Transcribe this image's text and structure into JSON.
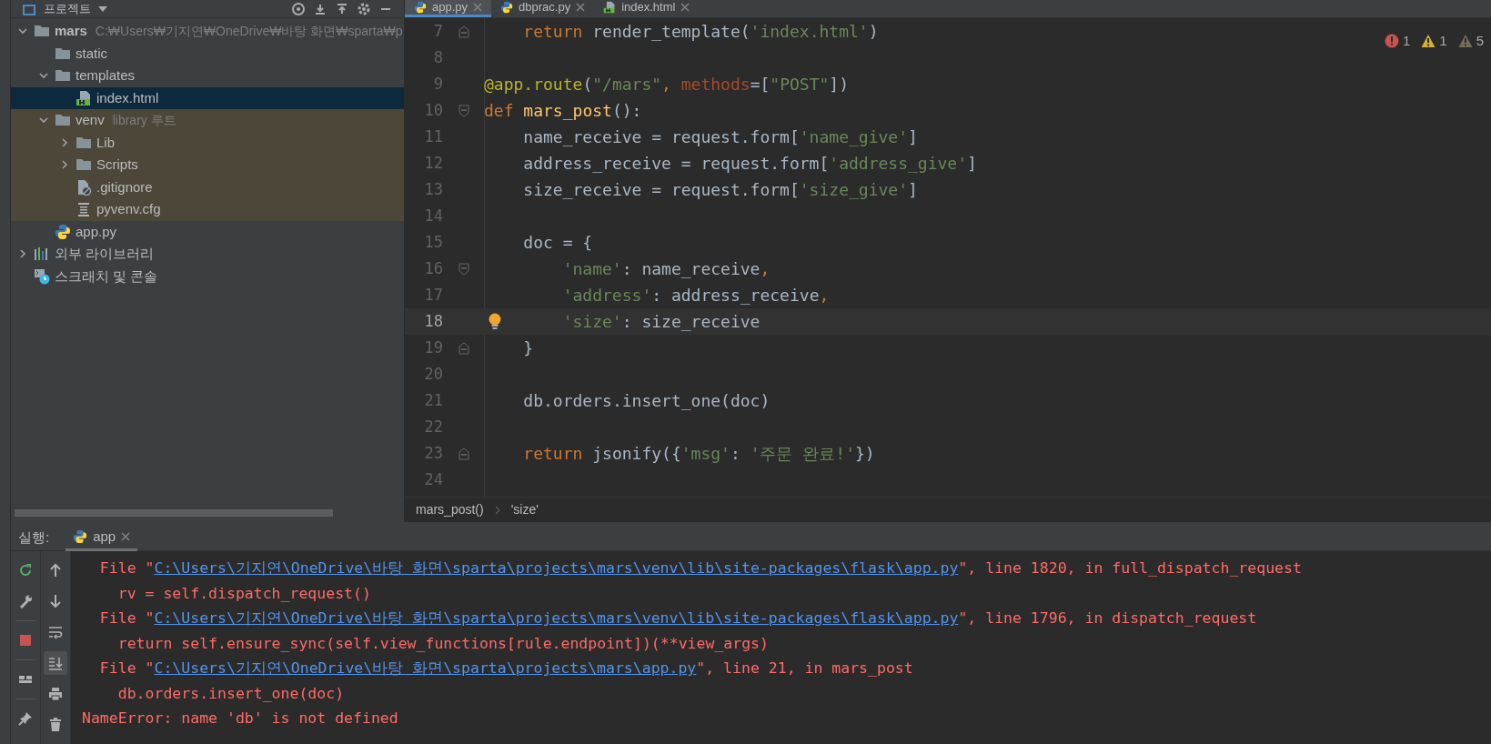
{
  "project_panel": {
    "title": "프로젝트",
    "tree": [
      {
        "label": "mars",
        "hint": "C:₩Users₩기지연₩OneDrive₩바탕 화면₩sparta₩p",
        "kind": "folder",
        "bold": true,
        "expanded": true,
        "selected": false,
        "children": [
          {
            "label": "static",
            "kind": "folder",
            "selected": false
          },
          {
            "label": "templates",
            "kind": "folder",
            "expanded": true,
            "selected": false,
            "children": [
              {
                "label": "index.html",
                "kind": "html",
                "selected": true
              }
            ]
          },
          {
            "label": "venv",
            "hint": "library 루트",
            "kind": "folder",
            "expanded": true,
            "library_root": true,
            "selected": false,
            "children": [
              {
                "label": "Lib",
                "kind": "folder",
                "expanded": false,
                "selected": false
              },
              {
                "label": "Scripts",
                "kind": "folder",
                "expanded": false,
                "selected": false
              },
              {
                "label": ".gitignore",
                "kind": "ignore",
                "selected": false
              },
              {
                "label": "pyvenv.cfg",
                "kind": "config",
                "selected": false
              }
            ]
          },
          {
            "label": "app.py",
            "kind": "python",
            "selected": false
          }
        ]
      },
      {
        "label": "외부 라이브러리",
        "kind": "library",
        "expanded": false,
        "selected": false
      },
      {
        "label": "스크래치 및 콘솔",
        "kind": "scratch",
        "selected": false
      }
    ]
  },
  "editor": {
    "tabs": [
      {
        "label": "app.py",
        "kind": "python",
        "selected": true
      },
      {
        "label": "dbprac.py",
        "kind": "python",
        "selected": false
      },
      {
        "label": "index.html",
        "kind": "html",
        "selected": false
      }
    ],
    "problems": [
      {
        "kind": "error",
        "count": "1"
      },
      {
        "kind": "warning",
        "count": "1"
      },
      {
        "kind": "weak",
        "count": "5"
      }
    ],
    "lines": [
      {
        "number": "7",
        "current": false,
        "fold_close": true,
        "tokens": [
          {
            "text": "    return",
            "kind": "kw"
          },
          {
            "text": " render_template(",
            "kind": "txt"
          },
          {
            "text": "'index.html'",
            "kind": "str"
          },
          {
            "text": ")",
            "kind": "txt"
          }
        ]
      },
      {
        "number": "8",
        "current": false
      },
      {
        "number": "9",
        "current": false,
        "tokens": [
          {
            "text": "@app.route",
            "kind": "deco"
          },
          {
            "text": "(",
            "kind": "txt"
          },
          {
            "text": "\"/mars\"",
            "kind": "str"
          },
          {
            "text": ", ",
            "kind": "kw"
          },
          {
            "text": "methods",
            "kind": "param"
          },
          {
            "text": "=[",
            "kind": "txt"
          },
          {
            "text": "\"POST\"",
            "kind": "str"
          },
          {
            "text": "])",
            "kind": "txt"
          }
        ]
      },
      {
        "number": "10",
        "current": false,
        "fold_open": true,
        "tokens": [
          {
            "text": "def ",
            "kind": "kw"
          },
          {
            "text": "mars_post",
            "kind": "fn"
          },
          {
            "text": "():",
            "kind": "txt"
          }
        ]
      },
      {
        "number": "11",
        "current": false,
        "tokens": [
          {
            "text": "    name_receive = request.form[",
            "kind": "txt"
          },
          {
            "text": "'name_give'",
            "kind": "str"
          },
          {
            "text": "]",
            "kind": "txt"
          }
        ]
      },
      {
        "number": "12",
        "current": false,
        "tokens": [
          {
            "text": "    address_receive = request.form[",
            "kind": "txt"
          },
          {
            "text": "'address_give'",
            "kind": "str"
          },
          {
            "text": "]",
            "kind": "txt"
          }
        ]
      },
      {
        "number": "13",
        "current": false,
        "tokens": [
          {
            "text": "    size_receive = request.form[",
            "kind": "txt"
          },
          {
            "text": "'size_give'",
            "kind": "str"
          },
          {
            "text": "]",
            "kind": "txt"
          }
        ]
      },
      {
        "number": "14",
        "current": false
      },
      {
        "number": "15",
        "current": false,
        "tokens": [
          {
            "text": "    doc = {",
            "kind": "txt"
          }
        ]
      },
      {
        "number": "16",
        "current": false,
        "fold_open": true,
        "tokens": [
          {
            "text": "        'name'",
            "kind": "str"
          },
          {
            "text": ": name_receive",
            "kind": "txt"
          },
          {
            "text": ",",
            "kind": "kw"
          }
        ]
      },
      {
        "number": "17",
        "current": false,
        "tokens": [
          {
            "text": "        'address'",
            "kind": "str"
          },
          {
            "text": ": address_receive",
            "kind": "txt"
          },
          {
            "text": ",",
            "kind": "kw"
          }
        ]
      },
      {
        "number": "18",
        "current": true,
        "bulb": true,
        "tokens": [
          {
            "text": "        'size'",
            "kind": "str"
          },
          {
            "text": ": size_receive",
            "kind": "txt"
          }
        ]
      },
      {
        "number": "19",
        "current": false,
        "fold_close": true,
        "tokens": [
          {
            "text": "    }",
            "kind": "txt"
          }
        ]
      },
      {
        "number": "20",
        "current": false
      },
      {
        "number": "21",
        "current": false,
        "tokens": [
          {
            "text": "    db.orders.insert_one(doc)",
            "kind": "txt"
          }
        ]
      },
      {
        "number": "22",
        "current": false
      },
      {
        "number": "23",
        "current": false,
        "fold_close": true,
        "tokens": [
          {
            "text": "    return",
            "kind": "kw"
          },
          {
            "text": " jsonify({",
            "kind": "txt"
          },
          {
            "text": "'msg'",
            "kind": "str"
          },
          {
            "text": ": ",
            "kind": "txt"
          },
          {
            "text": "'주문 완료!'",
            "kind": "str"
          },
          {
            "text": "})",
            "kind": "txt"
          }
        ]
      },
      {
        "number": "24",
        "current": false
      }
    ],
    "breadcrumbs": [
      "mars_post()",
      "'size'"
    ]
  },
  "run_panel": {
    "label": "실행:",
    "tab": {
      "label": "app",
      "selected": true
    },
    "tools_left": [
      {
        "kind": "rerun",
        "active": false
      },
      {
        "kind": "wrench",
        "active": false
      },
      {
        "kind": "stop",
        "active": false
      },
      {
        "kind": "layout",
        "active": false
      },
      {
        "kind": "pin",
        "active": false
      }
    ],
    "tools_right": [
      {
        "kind": "up",
        "active": false
      },
      {
        "kind": "down",
        "active": false
      },
      {
        "kind": "wrap",
        "active": false
      },
      {
        "kind": "scroll-end",
        "active": true
      },
      {
        "kind": "print",
        "active": false
      },
      {
        "kind": "trash",
        "active": false
      }
    ],
    "console": [
      {
        "segments": [
          {
            "text": "  File \"",
            "kind": "err"
          },
          {
            "text": "C:\\Users\\기지연\\OneDrive\\바탕 화면\\sparta\\projects\\mars\\venv\\lib\\site-packages\\flask\\app.py",
            "kind": "link"
          },
          {
            "text": "\", line 1820, in full_dispatch_request",
            "kind": "err"
          }
        ]
      },
      {
        "segments": [
          {
            "text": "    rv = self.dispatch_request()",
            "kind": "err"
          }
        ]
      },
      {
        "segments": [
          {
            "text": "  File \"",
            "kind": "err"
          },
          {
            "text": "C:\\Users\\기지연\\OneDrive\\바탕 화면\\sparta\\projects\\mars\\venv\\lib\\site-packages\\flask\\app.py",
            "kind": "link"
          },
          {
            "text": "\", line 1796, in dispatch_request",
            "kind": "err"
          }
        ]
      },
      {
        "segments": [
          {
            "text": "    return self.ensure_sync(self.view_functions[rule.endpoint])(**view_args)",
            "kind": "err"
          }
        ]
      },
      {
        "segments": [
          {
            "text": "  File \"",
            "kind": "err"
          },
          {
            "text": "C:\\Users\\기지연\\OneDrive\\바탕 화면\\sparta\\projects\\mars\\app.py",
            "kind": "link"
          },
          {
            "text": "\", line 21, in mars_post",
            "kind": "err"
          }
        ]
      },
      {
        "segments": [
          {
            "text": "    db.orders.insert_one(doc)",
            "kind": "err"
          }
        ]
      },
      {
        "segments": [
          {
            "text": "NameError: name 'db' is not defined",
            "kind": "err"
          }
        ]
      }
    ]
  }
}
